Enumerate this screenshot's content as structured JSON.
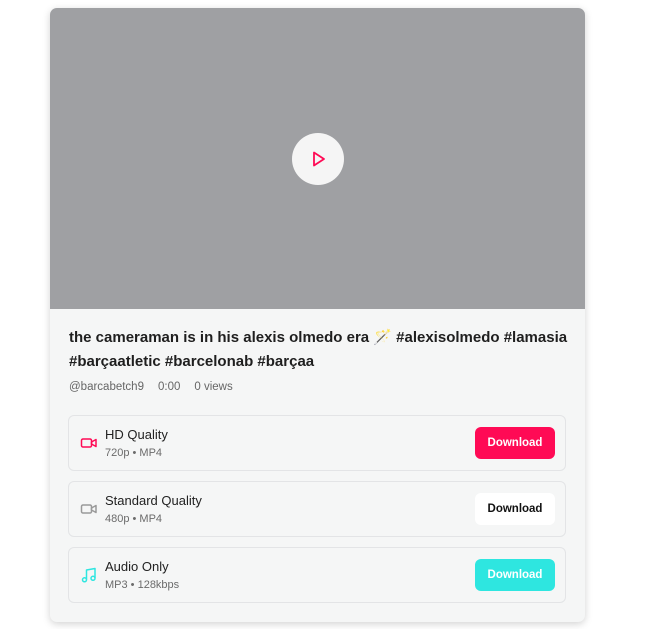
{
  "video": {
    "title": "the cameraman is in his alexis olmedo era 🪄 #alexisolmedo #lamasia #barçaatletic #barcelonab #barçaa",
    "author": "@barcabetch9",
    "duration": "0:00",
    "views": "0 views"
  },
  "options": [
    {
      "name": "HD Quality",
      "detail": "720p • MP4",
      "button": "Download",
      "icon": "video-icon",
      "accent": "#ff0a55"
    },
    {
      "name": "Standard Quality",
      "detail": "480p • MP4",
      "button": "Download",
      "icon": "video-icon",
      "accent": "#9a9a9a"
    },
    {
      "name": "Audio Only",
      "detail": "MP3 • 128kbps",
      "button": "Download",
      "icon": "music-note-icon",
      "accent": "#2ee6e0"
    }
  ],
  "colors": {
    "hd": "#ff0a55",
    "standard": "#ffffff",
    "audio": "#2ee6e0",
    "play_icon": "#ff0a55",
    "video_placeholder": "#9fa0a3"
  }
}
